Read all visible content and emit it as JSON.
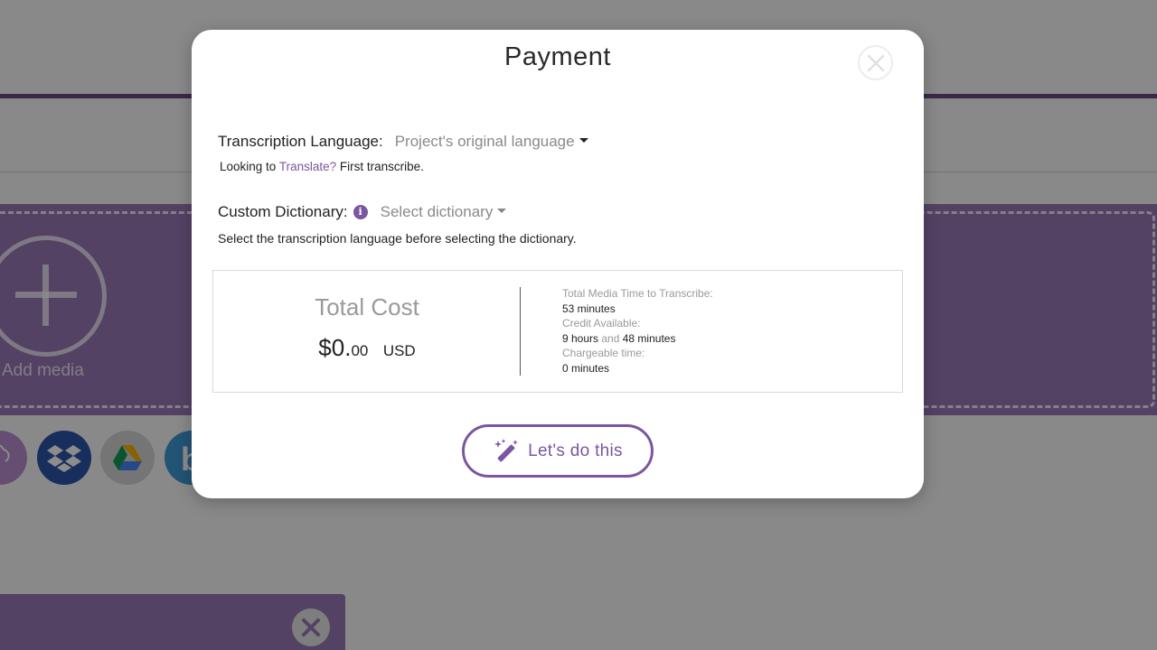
{
  "background": {
    "add_media_label": "Add media"
  },
  "modal": {
    "title": "Payment",
    "transcription_language": {
      "label": "Transcription Language:",
      "selected": "Project's original language"
    },
    "translate_hint": {
      "prefix": "Looking to",
      "link": "Translate?",
      "suffix": "First transcribe."
    },
    "custom_dictionary": {
      "label": "Custom Dictionary:",
      "placeholder": "Select dictionary",
      "note": "Select the transcription language before selecting the dictionary."
    },
    "cost": {
      "title": "Total Cost",
      "amount_main": "$0.",
      "amount_cents": "00",
      "currency": "USD",
      "media_time_label": "Total Media Time to Transcribe:",
      "media_time_value": "53 minutes",
      "credit_label": "Credit Available:",
      "credit_hours": "9 hours",
      "credit_and": "and",
      "credit_minutes": "48 minutes",
      "chargeable_label": "Chargeable time:",
      "chargeable_value": "0 minutes"
    },
    "cta_label": "Let's do this"
  },
  "colors": {
    "accent": "#7b56a0",
    "dropzone": "#9a78b8"
  },
  "icons": {
    "close": "close-icon",
    "info": "info-icon",
    "cta": "magic-wand-icon",
    "sources": [
      "cloud-upload-icon",
      "dropbox-icon",
      "google-drive-icon",
      "box-icon"
    ]
  }
}
